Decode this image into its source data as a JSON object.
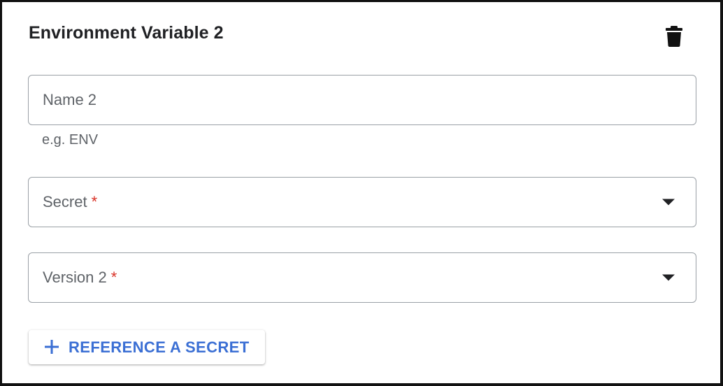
{
  "card": {
    "title": "Environment Variable 2",
    "delete_icon": "trash-icon"
  },
  "fields": {
    "name": {
      "label": "Name 2",
      "hint": "e.g. ENV"
    },
    "secret": {
      "label": "Secret",
      "required_mark": "*",
      "dropdown_icon": "caret-down-icon"
    },
    "version": {
      "label": "Version 2",
      "required_mark": "*",
      "dropdown_icon": "caret-down-icon"
    }
  },
  "actions": {
    "reference_secret": {
      "label": "REFERENCE A SECRET",
      "icon": "plus-icon"
    }
  },
  "colors": {
    "accent": "#3b6fd4",
    "required": "#d93025",
    "text_primary": "#202124",
    "text_secondary": "#5f6368",
    "border": "#9aa0a6"
  }
}
